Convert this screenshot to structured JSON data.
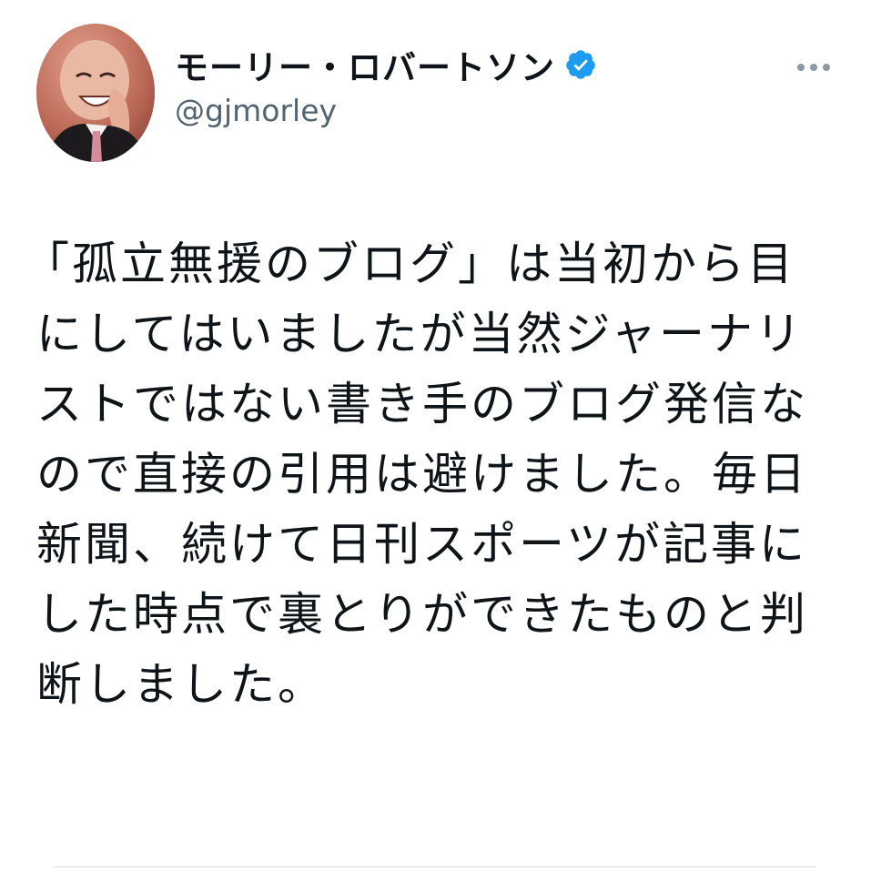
{
  "author": {
    "display_name": "モーリー・ロバートソン",
    "handle": "@gjmorley",
    "verified": true,
    "avatar_icon": "profile-photo",
    "verified_icon": "verified-badge-icon",
    "verified_color": "#1d9bf0"
  },
  "actions": {
    "more_icon": "more-horizontal-icon"
  },
  "tweet": {
    "lines": [
      "「孤立無援のブログ」は当初から目",
      "にしてはいましたが当然ジャーナリ",
      "ストではない書き手のブログ発信な",
      "ので直接の引用は避けました。毎日",
      "新聞、続けて日刊スポーツが記事に",
      "した時点で裏とりができたものと判",
      "断しました。"
    ]
  },
  "colors": {
    "text_primary": "#0f1419",
    "text_secondary": "#536471",
    "divider": "#cfd9de"
  }
}
